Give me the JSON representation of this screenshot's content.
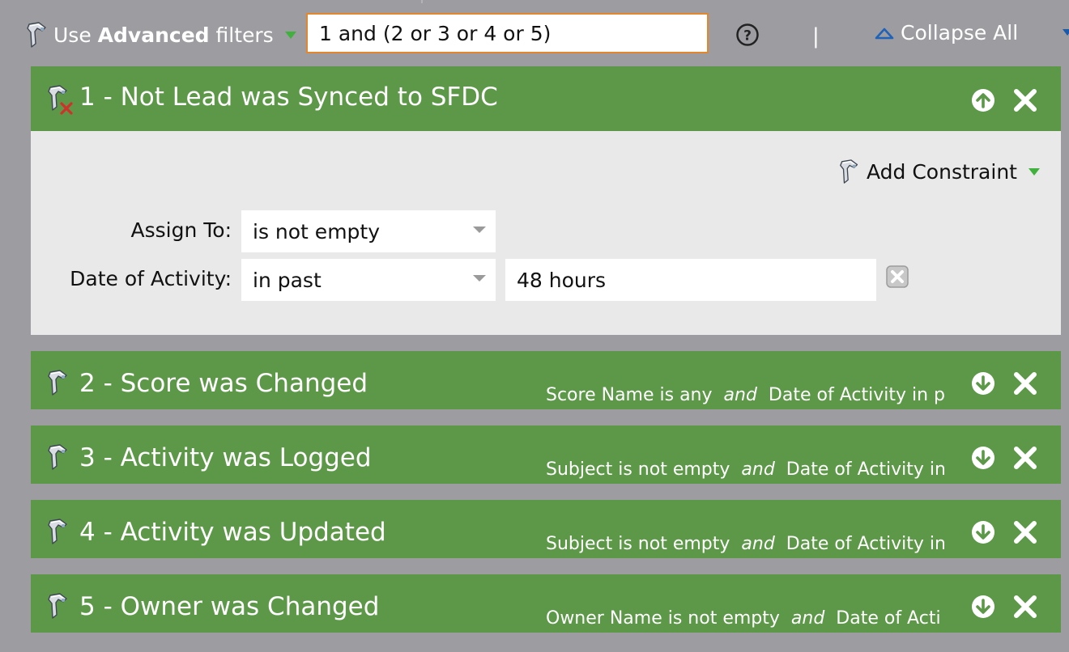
{
  "toolbar": {
    "use_label": "Use",
    "advanced_label": "Advanced",
    "filters_label": "filters",
    "logic_value": "1 and (2 or 3 or 4 or 5)",
    "separator": "|",
    "collapse_label": "Collapse All"
  },
  "filters": [
    {
      "title": "1 - Not Lead was Synced to SFDC",
      "negated": true,
      "expanded": true,
      "add_constraint_label": "Add Constraint",
      "constraints": [
        {
          "label": "Assign To:",
          "operator": "is not empty",
          "value": ""
        },
        {
          "label": "Date of Activity:",
          "operator": "in past",
          "value": "48 hours"
        }
      ]
    },
    {
      "title": "2 - Score was Changed",
      "summary_a": "Score Name is any",
      "summary_and": "and",
      "summary_b": "Date of Activity in pa"
    },
    {
      "title": "3 - Activity was Logged",
      "summary_a": "Subject is not empty",
      "summary_and": "and",
      "summary_b": "Date of Activity in"
    },
    {
      "title": "4 - Activity was Updated",
      "summary_a": "Subject is not empty",
      "summary_and": "and",
      "summary_b": "Date of Activity in"
    },
    {
      "title": "5 - Owner was Changed",
      "summary_a": "Owner Name is not empty",
      "summary_and": "and",
      "summary_b": "Date of Acti"
    }
  ],
  "colors": {
    "background": "#9d9ca1",
    "header_green": "#5c9848",
    "body_gray": "#e9e9e9",
    "input_border": "#e3862c"
  },
  "icons": {
    "filter_tool": "funnel-wand-icon",
    "negated_tool": "funnel-wand-x-icon",
    "help": "help-circle-icon",
    "collapse": "triangle-up-icon",
    "move_up": "arrow-up-circle-icon",
    "move_down": "arrow-down-circle-icon",
    "remove": "close-icon",
    "delete_value": "delete-box-icon"
  }
}
